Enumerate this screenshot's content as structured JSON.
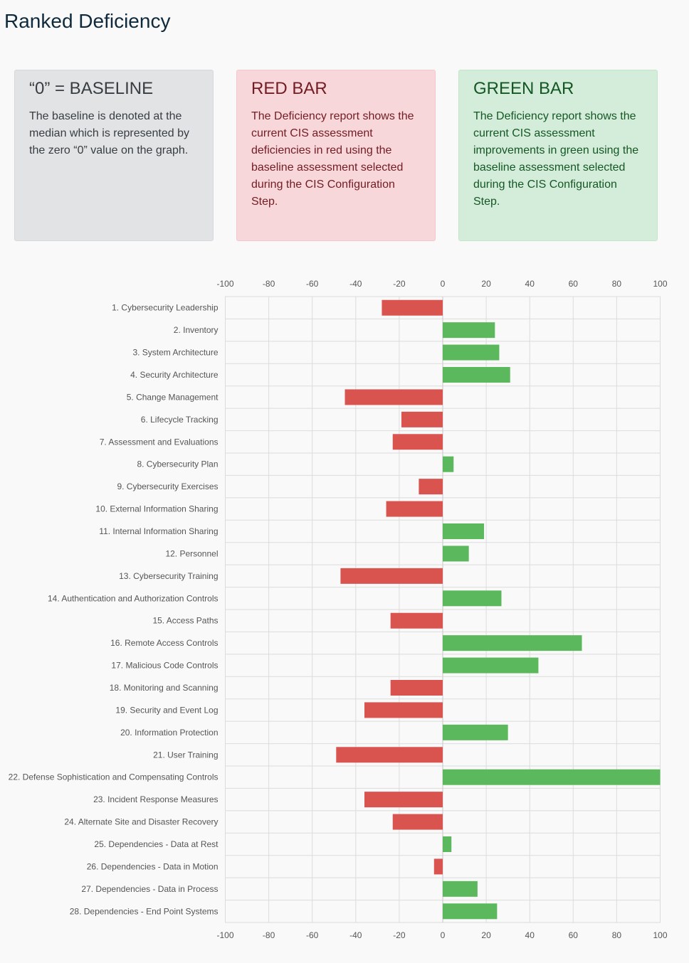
{
  "page": {
    "title": "Ranked Deficiency"
  },
  "cards": [
    {
      "title": "“0” = BASELINE",
      "body": "The baseline is denoted at the median which is represented by the zero “0” value on the graph."
    },
    {
      "title": "RED BAR",
      "body": "The Deficiency report shows the current CIS assessment deficiencies in red using the baseline assessment selected during the CIS Configuration Step."
    },
    {
      "title": "GREEN BAR",
      "body": "The Deficiency report shows the current CIS assessment improvements in green using the baseline assessment selected during the CIS Configuration Step."
    }
  ],
  "colors": {
    "negative": "#d9534f",
    "positive": "#5cb85c",
    "grid": "#dcdcdc",
    "axis": "#555555"
  },
  "chart_data": {
    "type": "bar",
    "orientation": "horizontal",
    "xlim": [
      -100,
      100
    ],
    "xticks": [
      -100,
      -80,
      -60,
      -40,
      -20,
      0,
      20,
      40,
      60,
      80,
      100
    ],
    "grid": true,
    "categories": [
      "1. Cybersecurity Leadership",
      "2. Inventory",
      "3. System Architecture",
      "4. Security Architecture",
      "5. Change Management",
      "6. Lifecycle Tracking",
      "7. Assessment and Evaluations",
      "8. Cybersecurity Plan",
      "9. Cybersecurity Exercises",
      "10. External Information Sharing",
      "11. Internal Information Sharing",
      "12. Personnel",
      "13. Cybersecurity Training",
      "14. Authentication and Authorization Controls",
      "15. Access Paths",
      "16. Remote Access Controls",
      "17. Malicious Code Controls",
      "18. Monitoring and Scanning",
      "19. Security and Event Log",
      "20. Information Protection",
      "21. User Training",
      "22. Defense Sophistication and Compensating Controls",
      "23. Incident Response Measures",
      "24. Alternate Site and Disaster Recovery",
      "25. Dependencies - Data at Rest",
      "26. Dependencies - Data in Motion",
      "27. Dependencies - Data in Process",
      "28. Dependencies - End Point Systems"
    ],
    "values": [
      -28,
      24,
      26,
      31,
      -45,
      -19,
      -23,
      5,
      -11,
      -26,
      19,
      12,
      -47,
      27,
      -24,
      64,
      44,
      -24,
      -36,
      30,
      -49,
      100,
      -36,
      -23,
      4,
      -4,
      16,
      25
    ]
  }
}
